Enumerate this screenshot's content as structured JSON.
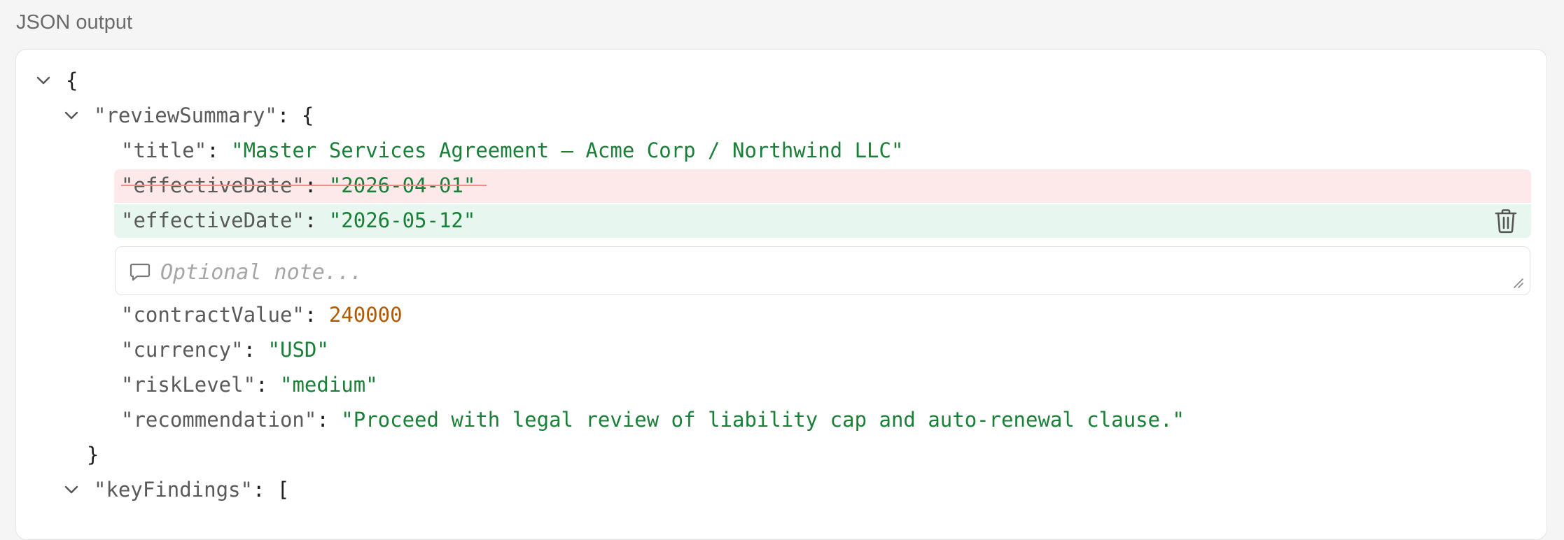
{
  "section": {
    "title": "JSON output"
  },
  "tree": {
    "root_open": "{",
    "review_key": "\"reviewSummary\"",
    "colon_brace": ": {",
    "title_key": "\"title\"",
    "title_val": "\"Master Services Agreement — Acme Corp / Northwind LLC\"",
    "eff_del_key": "\"effectiveDate\"",
    "eff_del_val": "\"2026-04-01\"",
    "eff_add_key": "\"effectiveDate\"",
    "eff_add_val": "\"2026-05-12\"",
    "contract_key": "\"contractValue\"",
    "contract_val": "240000",
    "currency_key": "\"currency\"",
    "currency_val": "\"USD\"",
    "risk_key": "\"riskLevel\"",
    "risk_val": "\"medium\"",
    "rec_key": "\"recommendation\"",
    "rec_val": "\"Proceed with legal review of liability cap and auto-renewal clause.\"",
    "close_brace": "}",
    "findings_key": "\"keyFindings\"",
    "colon_bracket": ": ["
  },
  "note": {
    "placeholder": "Optional note..."
  },
  "icons": {
    "collapse": "chevron-down-icon",
    "delete": "trash-icon",
    "note": "comment-icon",
    "resize": "resize-grip-icon"
  },
  "colors": {
    "string": "#1a7f37",
    "number": "#b35900",
    "deleted_bg": "#fde9ea",
    "added_bg": "#e7f6ef",
    "strike": "#f08a8a"
  }
}
